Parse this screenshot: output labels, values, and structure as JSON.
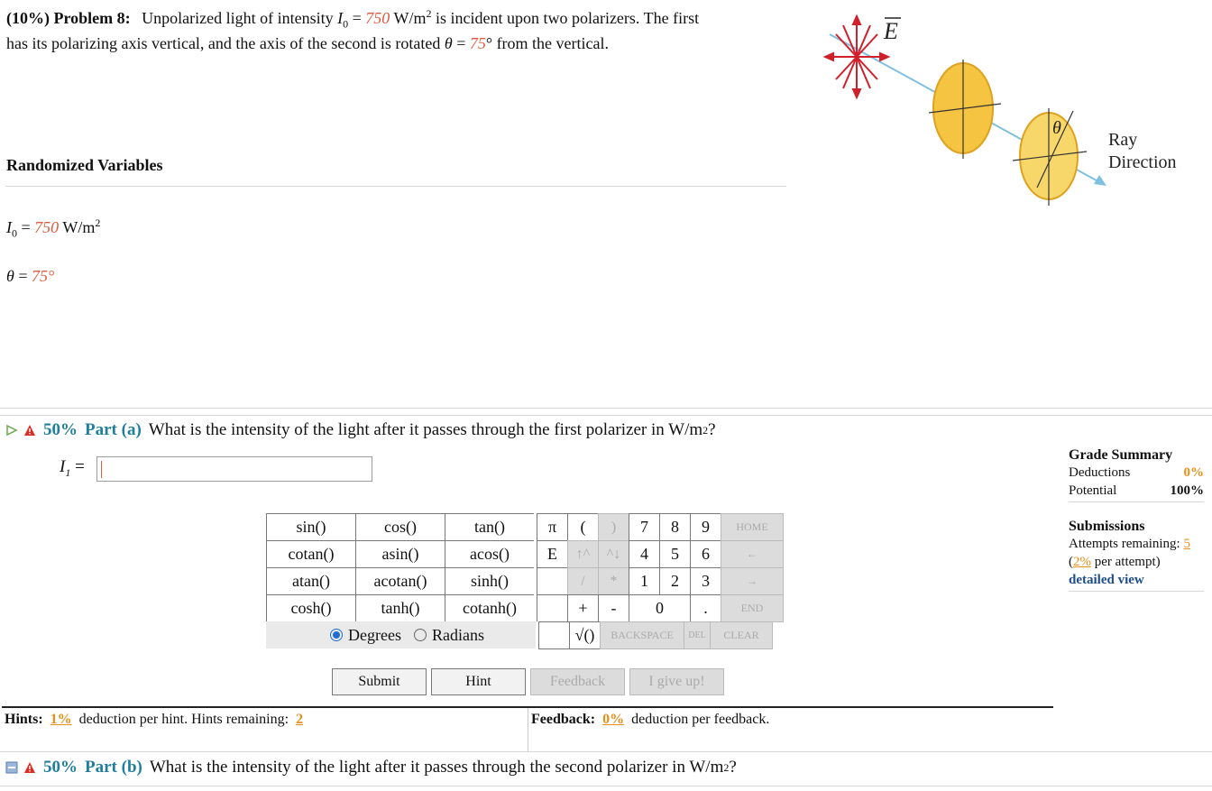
{
  "problem": {
    "weight": "(10%)",
    "number": "Problem 8:",
    "text_a": "Unpolarized light of intensity",
    "i0_symbol": "I",
    "i0_sub": "0",
    "eq": "=",
    "i0_value": "750",
    "unit": "W/m",
    "unit_exp": "2",
    "text_b": "is incident upon two polarizers. The first",
    "text_c": "has its polarizing axis vertical, and the axis of the second is rotated",
    "theta_symbol": "θ",
    "theta_value": "75",
    "deg": "°",
    "text_d": "from the vertical."
  },
  "randomized": {
    "title": "Randomized Variables",
    "i0_symbol": "I",
    "i0_sub": "0",
    "eq": "=",
    "i0_value": "750",
    "unit": "W/m",
    "unit_exp": "2",
    "theta_symbol": "θ",
    "theta_value": "75",
    "deg": "°"
  },
  "diagram": {
    "e_label": "E",
    "theta_label": "θ",
    "ray_line1": "Ray",
    "ray_line2": "Direction"
  },
  "part_a": {
    "percent": "50%",
    "name": "Part (a)",
    "question": "What is the intensity of the light after it passes through the first polarizer in W/m",
    "q_exp": "2",
    "q_end": "?",
    "answer_symbol": "I",
    "answer_sub": "1",
    "answer_eq": "=",
    "answer_value": ""
  },
  "keypad": {
    "functions": [
      [
        "sin()",
        "cos()",
        "tan()"
      ],
      [
        "cotan()",
        "asin()",
        "acos()"
      ],
      [
        "atan()",
        "acotan()",
        "sinh()"
      ],
      [
        "cosh()",
        "tanh()",
        "cotanh()"
      ]
    ],
    "pi": "π",
    "lparen": "(",
    "rparen": ")",
    "e": "E",
    "up": "↑^",
    "down": "^↓",
    "slash": "/",
    "star": "*",
    "plus": "+",
    "minus": "-",
    "sqrt": "√()",
    "digits_row1": [
      "7",
      "8",
      "9"
    ],
    "digits_row2": [
      "4",
      "5",
      "6"
    ],
    "digits_row3": [
      "1",
      "2",
      "3"
    ],
    "zero": "0",
    "dot": ".",
    "home": "HOME",
    "left": "←",
    "right": "→",
    "end": "END",
    "backspace": "BACKSPACE",
    "del": "DEL",
    "clear": "CLEAR",
    "degrees": "Degrees",
    "radians": "Radians",
    "angle_mode": "Degrees"
  },
  "actions": {
    "submit": "Submit",
    "hint": "Hint",
    "feedback": "Feedback",
    "give_up": "I give up!"
  },
  "hints": {
    "label": "Hints:",
    "deduction": "1%",
    "text": "deduction per hint. Hints remaining:",
    "remaining": "2"
  },
  "feedback": {
    "label": "Feedback:",
    "deduction": "0%",
    "text": "deduction per feedback."
  },
  "grade": {
    "title": "Grade Summary",
    "deductions_label": "Deductions",
    "deductions_value": "0%",
    "potential_label": "Potential",
    "potential_value": "100%",
    "submissions_title": "Submissions",
    "attempts_label": "Attempts remaining:",
    "attempts_value": "5",
    "per_attempt_open": "(",
    "per_attempt_value": "2%",
    "per_attempt_text": "per attempt)",
    "detailed_view": "detailed view"
  },
  "part_b": {
    "percent": "50%",
    "name": "Part (b)",
    "question": "What is the intensity of the light after it passes through the second polarizer in W/m",
    "q_exp": "2",
    "q_end": "?"
  },
  "colors": {
    "accent_number": "#e05a3c",
    "part_title": "#1f7f9c",
    "orange": "#e8901a",
    "link": "#1d4e89"
  }
}
